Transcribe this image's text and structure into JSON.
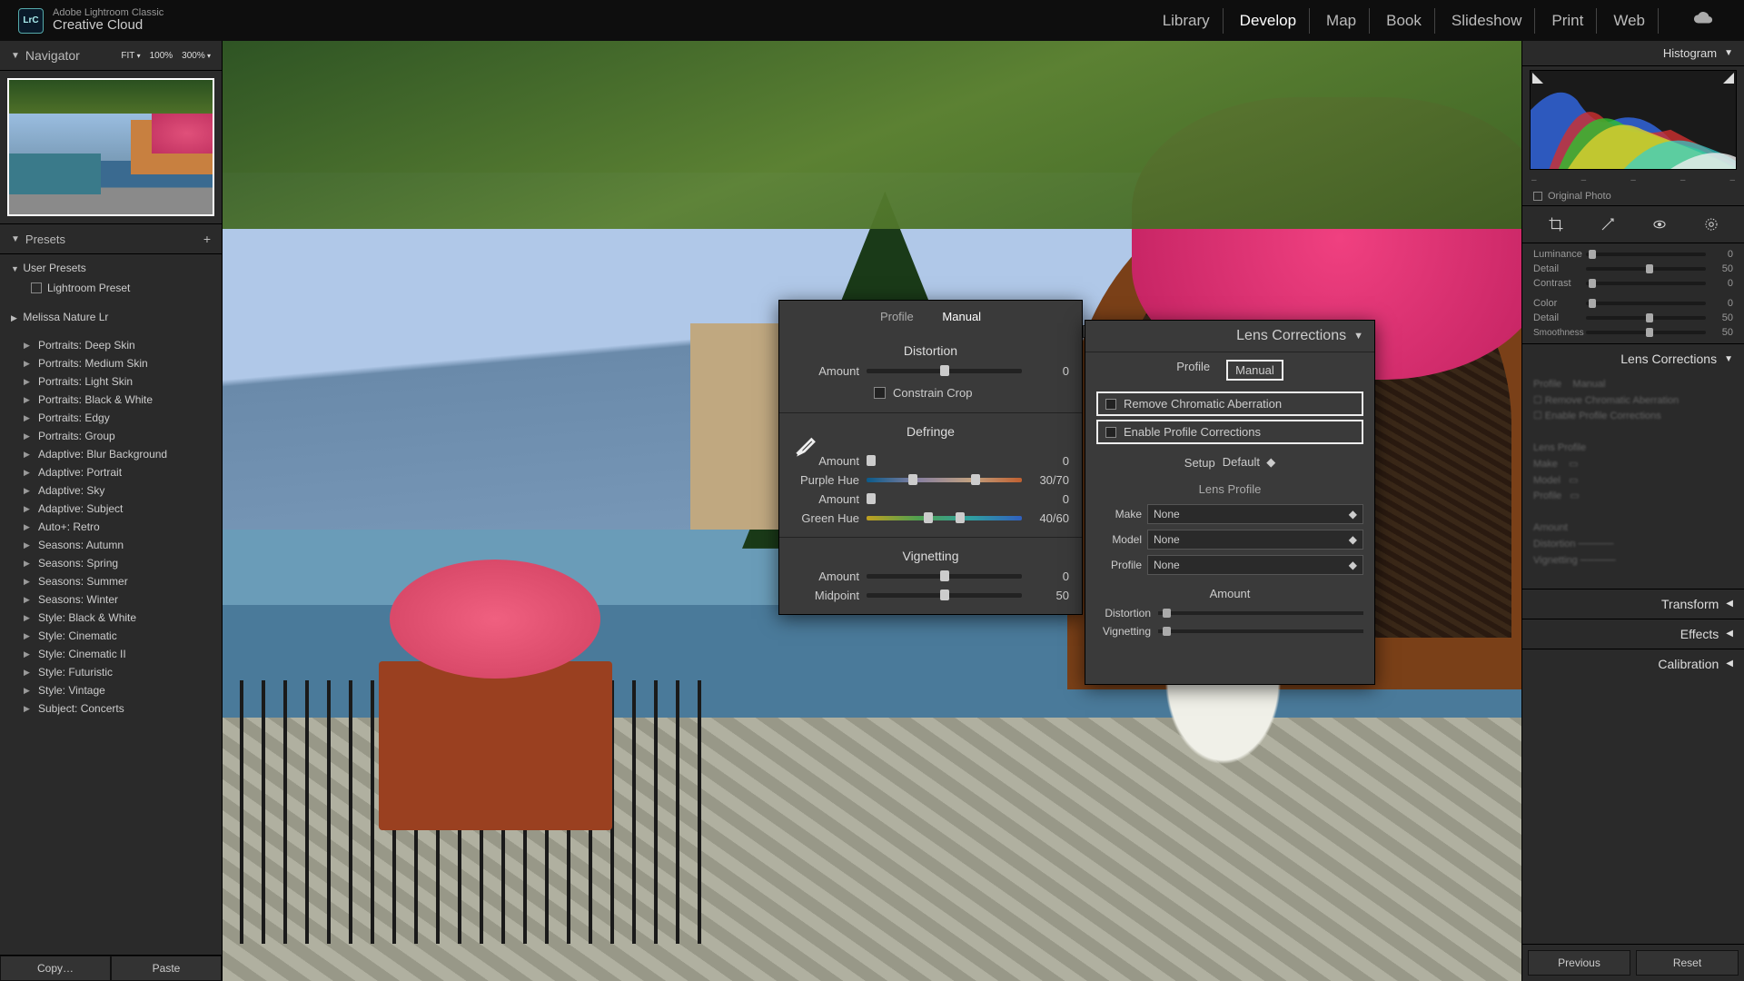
{
  "brand": {
    "logo": "LrC",
    "line1": "Adobe Lightroom Classic",
    "line2": "Creative Cloud"
  },
  "modules": [
    "Library",
    "Develop",
    "Map",
    "Book",
    "Slideshow",
    "Print",
    "Web"
  ],
  "active_module": "Develop",
  "navigator": {
    "title": "Navigator",
    "views": [
      "FIT",
      "100%",
      "300%"
    ]
  },
  "presets": {
    "title": "Presets",
    "user_group": "User Presets",
    "user_child": "Lightroom Preset",
    "group2": "Melissa Nature Lr",
    "items": [
      "Portraits: Deep Skin",
      "Portraits: Medium Skin",
      "Portraits: Light Skin",
      "Portraits: Black & White",
      "Portraits: Edgy",
      "Portraits: Group",
      "Adaptive: Blur Background",
      "Adaptive: Portrait",
      "Adaptive: Sky",
      "Adaptive: Subject",
      "Auto+: Retro",
      "Seasons: Autumn",
      "Seasons: Spring",
      "Seasons: Summer",
      "Seasons: Winter",
      "Style: Black & White",
      "Style: Cinematic",
      "Style: Cinematic II",
      "Style: Futuristic",
      "Style: Vintage",
      "Subject: Concerts"
    ],
    "copy": "Copy…",
    "paste": "Paste"
  },
  "rightTop": {
    "title": "Histogram",
    "original": "Original Photo",
    "sliders": [
      {
        "lbl": "Luminance",
        "val": "0",
        "pos": 2
      },
      {
        "lbl": "Detail",
        "val": "50",
        "pos": 50
      },
      {
        "lbl": "Contrast",
        "val": "0",
        "pos": 2
      },
      {
        "lbl": "Color",
        "val": "0",
        "pos": 2
      },
      {
        "lbl": "Detail",
        "val": "50",
        "pos": 50
      },
      {
        "lbl": "Smoothness",
        "val": "50",
        "pos": 50
      }
    ]
  },
  "rightSections": [
    "Lens Corrections",
    "Transform",
    "Effects",
    "Calibration"
  ],
  "prevReset": {
    "prev": "Previous",
    "reset": "Reset"
  },
  "manualPanel": {
    "tabs": [
      "Profile",
      "Manual"
    ],
    "distortion": {
      "title": "Distortion",
      "amount": "Amount",
      "amount_v": "0",
      "constrain": "Constrain Crop"
    },
    "defringe": {
      "title": "Defringe",
      "amount": "Amount",
      "amount_v": "0",
      "purple": "Purple Hue",
      "purple_v": "30/70",
      "amount2": "Amount",
      "amount2_v": "0",
      "green": "Green Hue",
      "green_v": "40/60"
    },
    "vign": {
      "title": "Vignetting",
      "amount": "Amount",
      "amount_v": "0",
      "mid": "Midpoint",
      "mid_v": "50"
    }
  },
  "profilePanel": {
    "title": "Lens Corrections",
    "tabs": [
      "Profile",
      "Manual"
    ],
    "chk1": "Remove Chromatic Aberration",
    "chk2": "Enable Profile Corrections",
    "setup": "Setup",
    "setup_v": "Default",
    "lp": "Lens Profile",
    "make": "Make",
    "model": "Model",
    "profile": "Profile",
    "none": "None",
    "amount": "Amount",
    "dist": "Distortion",
    "vign": "Vignetting"
  }
}
